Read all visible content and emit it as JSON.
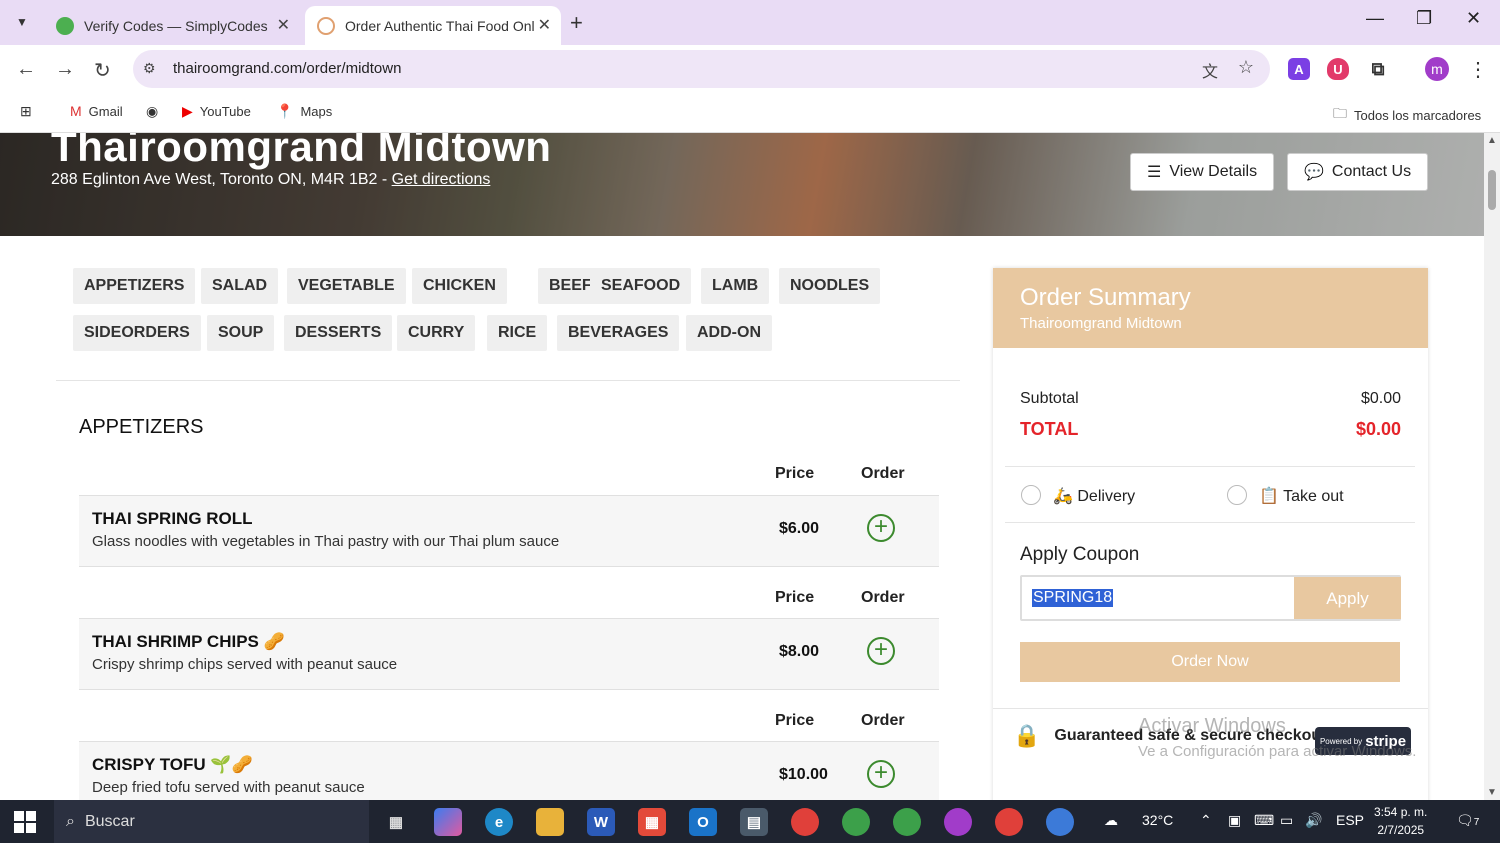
{
  "tabs": [
    {
      "title": "Verify Codes — SimplyCodes",
      "active": false
    },
    {
      "title": "Order Authentic Thai Food Onli",
      "active": true
    }
  ],
  "toolbar": {
    "url": "thairoomgrand.com/order/midtown"
  },
  "bookmarks": {
    "items": [
      "Gmail",
      "YouTube",
      "Maps"
    ],
    "all": "Todos los marcadores"
  },
  "restaurant": {
    "name": "Thairoomgrand Midtown",
    "address": "288 Eglinton Ave West, Toronto ON, M4R 1B2 - ",
    "directions": "Get directions",
    "view_details": "View Details",
    "contact_us": "Contact Us"
  },
  "categories": [
    [
      "APPETIZERS",
      "SALAD",
      "VEGETABLE",
      "CHICKEN",
      "BEEF",
      "SEAFOOD",
      "LAMB",
      "NOODLES"
    ],
    [
      "SIDEORDERS",
      "SOUP",
      "DESSERTS",
      "CURRY",
      "RICE",
      "BEVERAGES",
      "ADD-ON"
    ]
  ],
  "menu": {
    "section": "APPETIZERS",
    "price_header": "Price",
    "order_header": "Order",
    "items": [
      {
        "name": "THAI SPRING ROLL",
        "desc": "Glass noodles with vegetables in Thai pastry with our Thai plum sauce",
        "price": "$6.00",
        "icons": ""
      },
      {
        "name": "THAI SHRIMP CHIPS",
        "desc": "Crispy shrimp chips served with peanut sauce",
        "price": "$8.00",
        "icons": "🥜"
      },
      {
        "name": "CRISPY TOFU",
        "desc": "Deep fried tofu served with peanut sauce",
        "price": "$10.00",
        "icons": "🌱🥜"
      }
    ]
  },
  "summary": {
    "title": "Order Summary",
    "location": "Thairoomgrand Midtown",
    "subtotal_label": "Subtotal",
    "subtotal": "$0.00",
    "total_label": "TOTAL",
    "total": "$0.00",
    "delivery": "Delivery",
    "takeout": "Take out",
    "coupon_title": "Apply Coupon",
    "coupon_value": "SPRING18",
    "apply": "Apply",
    "order_now": "Order Now",
    "secure": "Guaranteed safe & secure checkout",
    "stripe_small": "Powered by",
    "stripe_big": "stripe"
  },
  "watermark": {
    "line1": "Activar Windows",
    "line2": "Ve a Configuración para activar Windows."
  },
  "taskbar": {
    "search": "Buscar",
    "weather": "32°C",
    "lang": "ESP",
    "time": "3:54 p. m.",
    "date": "2/7/2025",
    "notifications": "7"
  },
  "colors": {
    "accent": "#e8c8a0",
    "total_red": "#e4242a",
    "add_green": "#3c8a2e",
    "tabbar": "#e9dcf5"
  }
}
